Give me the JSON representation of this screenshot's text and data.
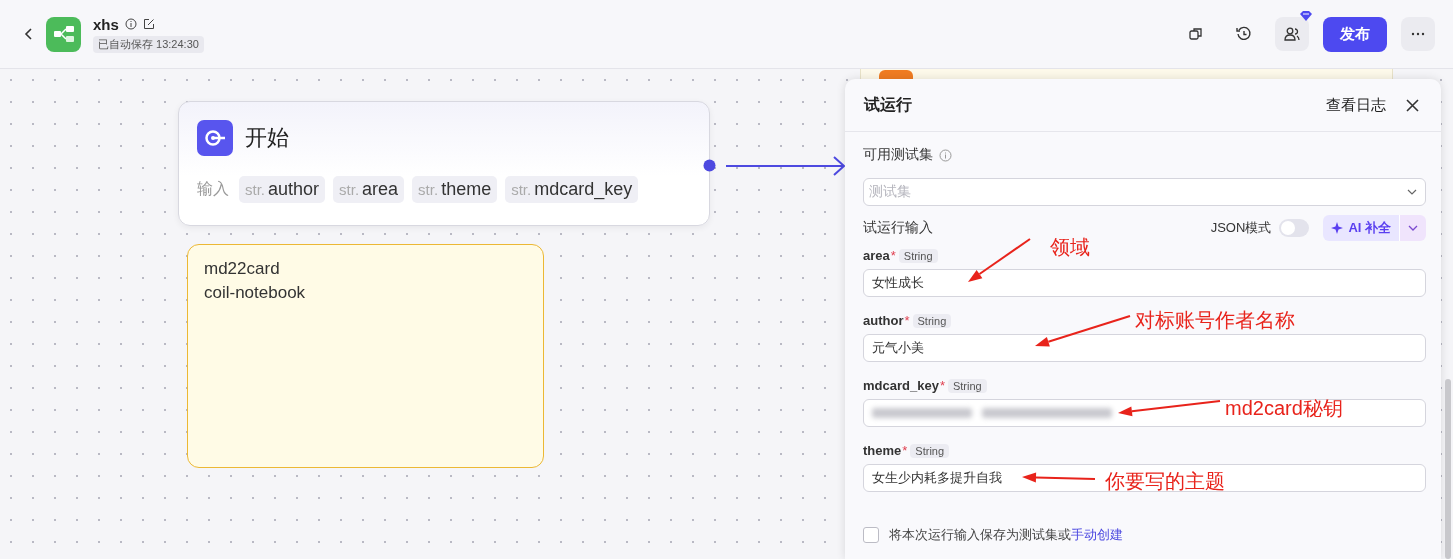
{
  "header": {
    "title": "xhs",
    "autosave": "已自动保存 13:24:30",
    "publish_button": "发布"
  },
  "canvas": {
    "start_node": {
      "title": "开始",
      "inputs_label": "输入",
      "inputs": [
        {
          "type": "str.",
          "name": "author"
        },
        {
          "type": "str.",
          "name": "area"
        },
        {
          "type": "str.",
          "name": "theme"
        },
        {
          "type": "str.",
          "name": "mdcard_key"
        }
      ]
    },
    "note": {
      "lines": [
        "md22card",
        "coil-notebook"
      ]
    }
  },
  "run_panel": {
    "title": "试运行",
    "log_link": "查看日志",
    "testset_label": "可用测试集",
    "testset_placeholder": "测试集",
    "input_section": "试运行输入",
    "json_mode": {
      "label": "JSON模式",
      "on": false
    },
    "ai_button": "AI 补全",
    "fields": [
      {
        "name": "area",
        "required_mark": "*",
        "type": "String",
        "value": "女性成长",
        "redacted": false,
        "annotation": "领域"
      },
      {
        "name": "author",
        "required_mark": "*",
        "type": "String",
        "value": "元气小美",
        "redacted": false,
        "annotation": "对标账号作者名称"
      },
      {
        "name": "mdcard_key",
        "required_mark": "*",
        "type": "String",
        "redacted": true,
        "annotation": "md2card秘钥"
      },
      {
        "name": "theme",
        "required_mark": "*",
        "type": "String",
        "value": "女生少内耗多提升自我",
        "redacted": false,
        "annotation": "你要写的主题"
      }
    ],
    "save_option": {
      "text": "将本次运行输入保存为测试集或",
      "link": "手动创建",
      "checked": false
    }
  }
}
